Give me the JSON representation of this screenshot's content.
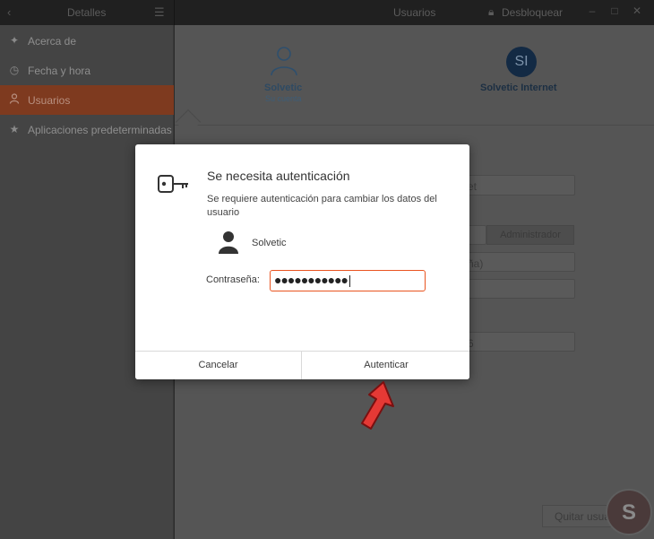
{
  "header": {
    "left_title": "Detalles",
    "title": "Usuarios",
    "unlock_label": "Desbloquear"
  },
  "sidebar": {
    "items": [
      {
        "label": "Acerca de",
        "icon": "sparkle-icon"
      },
      {
        "label": "Fecha y hora",
        "icon": "clock-icon"
      },
      {
        "label": "Usuarios",
        "icon": "person-icon",
        "active": true
      },
      {
        "label": "Aplicaciones predeterminadas",
        "icon": "star-icon"
      }
    ]
  },
  "main": {
    "users": [
      {
        "name": "Solvetic",
        "subtitle": "Su cuenta"
      },
      {
        "name": "Solvetic Internet",
        "initials": "SI"
      }
    ],
    "field_snippets": [
      "et",
      "ña)",
      "6"
    ],
    "admin_button": "Administrador",
    "quit_button": "Quitar usua"
  },
  "dialog": {
    "title": "Se necesita autenticación",
    "message": "Se requiere autenticación para cambiar los datos del usuario",
    "user": "Solvetic",
    "password_label": "Contraseña:",
    "password_value": "●●●●●●●●●●●",
    "cancel_label": "Cancelar",
    "ok_label": "Autenticar"
  },
  "colors": {
    "accent": "#e95420",
    "arrow": "#e53935"
  }
}
